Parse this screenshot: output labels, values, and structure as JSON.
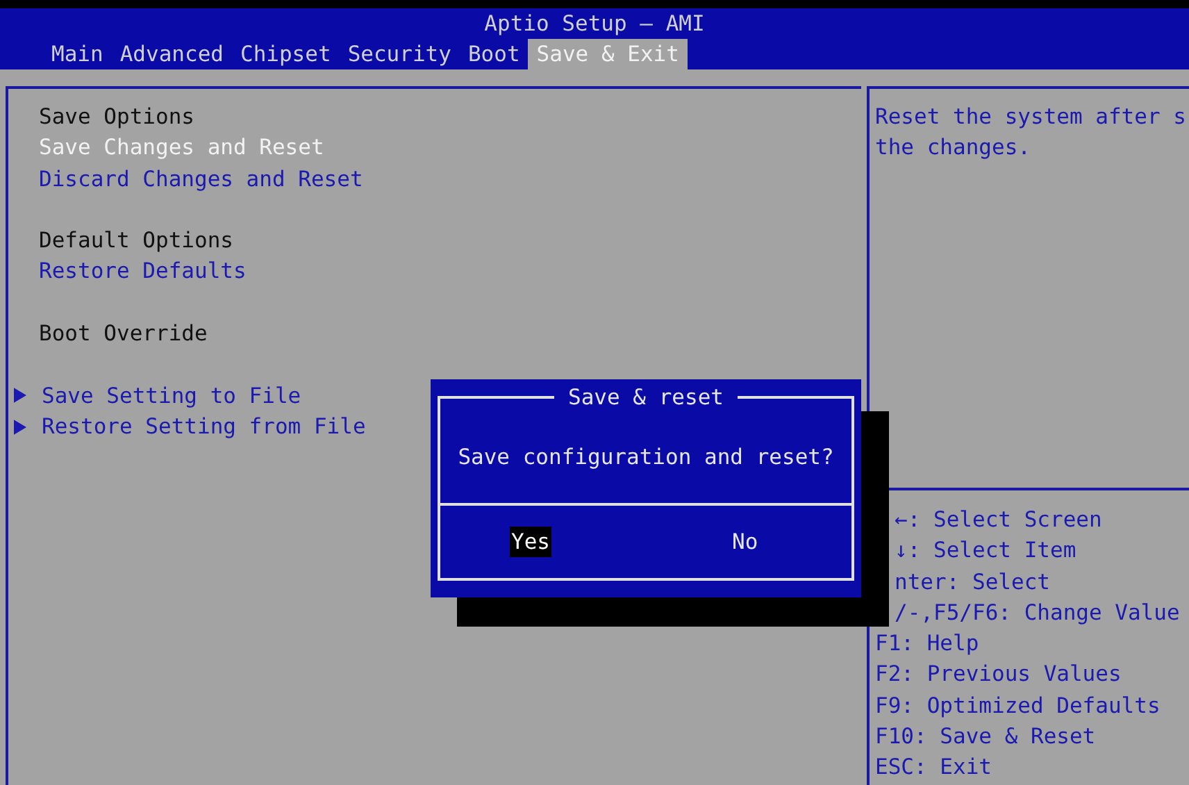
{
  "window": {
    "title": "Aptio Setup – AMI"
  },
  "tabs": [
    {
      "label": "Main",
      "selected": false
    },
    {
      "label": "Advanced",
      "selected": false
    },
    {
      "label": "Chipset",
      "selected": false
    },
    {
      "label": "Security",
      "selected": false
    },
    {
      "label": "Boot",
      "selected": false
    },
    {
      "label": "Save & Exit",
      "selected": true
    }
  ],
  "menu": {
    "groups": [
      {
        "items": [
          {
            "kind": "heading",
            "label": "Save Options",
            "selected": false
          },
          {
            "kind": "action",
            "label": "Save Changes and Reset",
            "selected": true
          },
          {
            "kind": "action",
            "label": "Discard Changes and Reset",
            "selected": false
          }
        ]
      },
      {
        "items": [
          {
            "kind": "heading",
            "label": "Default Options",
            "selected": false
          },
          {
            "kind": "action",
            "label": "Restore Defaults",
            "selected": false
          }
        ]
      },
      {
        "items": [
          {
            "kind": "heading",
            "label": "Boot Override",
            "selected": false
          }
        ]
      },
      {
        "items": [
          {
            "kind": "submenu",
            "label": "Save Setting to File",
            "selected": false
          },
          {
            "kind": "submenu",
            "label": "Restore Setting from File",
            "selected": false
          }
        ]
      }
    ]
  },
  "help": {
    "description": [
      "Reset the system after s",
      "the changes."
    ],
    "keys": [
      {
        "text": "←: Select Screen",
        "covered": true
      },
      {
        "text": "↓: Select Item",
        "covered": true
      },
      {
        "text": "nter: Select",
        "covered": true
      },
      {
        "text": "/-,F5/F6: Change Value",
        "covered": true
      },
      {
        "text": "F1: Help",
        "covered": false
      },
      {
        "text": "F2: Previous Values",
        "covered": false
      },
      {
        "text": "F9: Optimized Defaults",
        "covered": false
      },
      {
        "text": "F10: Save & Reset",
        "covered": false
      },
      {
        "text": "ESC: Exit",
        "covered": false
      }
    ]
  },
  "dialog": {
    "title": "Save & reset",
    "message": "Save configuration and reset?",
    "buttons": [
      {
        "label": "Yes",
        "selected": true
      },
      {
        "label": "No",
        "selected": false
      }
    ]
  }
}
